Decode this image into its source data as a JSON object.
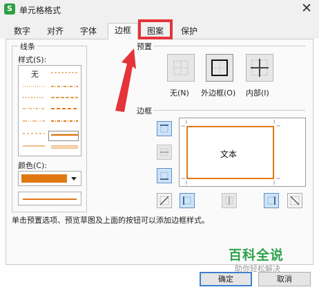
{
  "window": {
    "title": "单元格格式",
    "app_icon": "S"
  },
  "tabs": [
    {
      "label": "数字"
    },
    {
      "label": "对齐"
    },
    {
      "label": "字体"
    },
    {
      "label": "边框",
      "active": true
    },
    {
      "label": "图案",
      "highlighted": true
    },
    {
      "label": "保护"
    }
  ],
  "line_group": {
    "title": "线条",
    "style_label": "样式(S):",
    "none_label": "无",
    "color_label": "颜色(C):"
  },
  "preset_group": {
    "title": "预置",
    "items": [
      {
        "label": "无(N)",
        "icon": "no-border-icon"
      },
      {
        "label": "外边框(O)",
        "icon": "outline-border-icon"
      },
      {
        "label": "内部(I)",
        "icon": "inside-border-icon"
      }
    ]
  },
  "border_group": {
    "title": "边框",
    "preview_text": "文本"
  },
  "instruction": "单击预置选项、预览草图及上面的按钮可以添加边框样式。",
  "buttons": {
    "ok": "确定",
    "cancel": "取消"
  },
  "watermark": {
    "title": "百科全说",
    "subtitle": "助你轻松解决"
  },
  "colors": {
    "selected_line_color": "#e07812",
    "highlight": "#e5333a",
    "watermark_green": "#2ea24b",
    "button_on": "#cde4f7"
  }
}
